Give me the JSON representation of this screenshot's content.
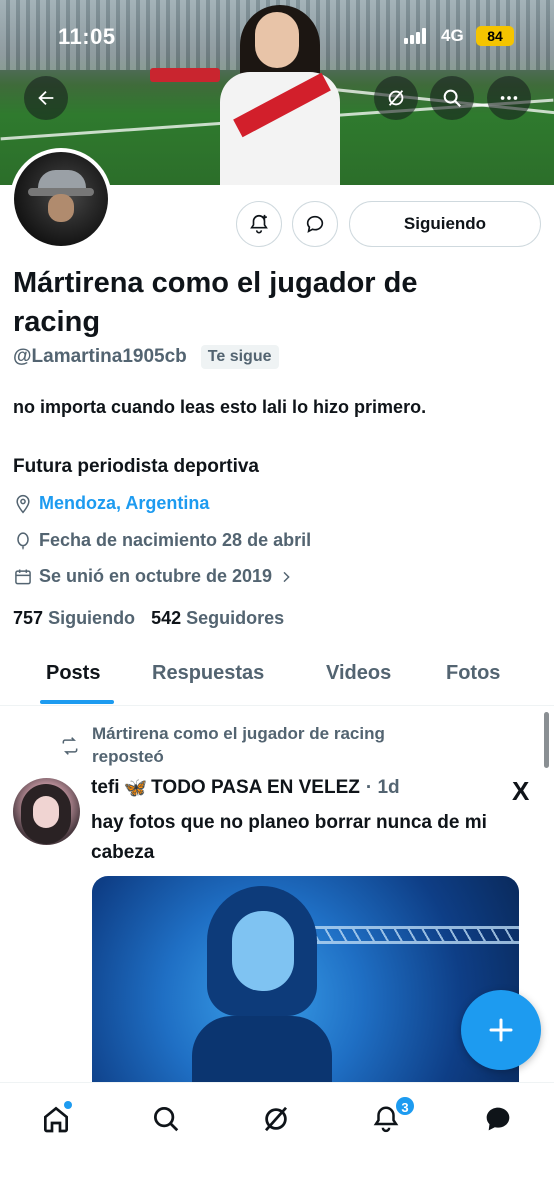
{
  "status_bar": {
    "time": "11:05",
    "network": "4G",
    "battery": "84"
  },
  "profile": {
    "name": "Mártirena como el jugador de racing",
    "handle": "@Lamartina1905cb",
    "follows_you": "Te sigue",
    "follow_button": "Siguiendo",
    "bio": "no importa cuando leas esto lali lo hizo primero.",
    "bio_line2": "Futura periodista deportiva",
    "location": "Mendoza, Argentina",
    "birthday": "Fecha de nacimiento 28 de abril",
    "joined": "Se unió en octubre de 2019",
    "following_count": "757",
    "following_label": "Siguiendo",
    "followers_count": "542",
    "followers_label": "Seguidores"
  },
  "tabs": [
    "Posts",
    "Respuestas",
    "Videos",
    "Fotos"
  ],
  "active_tab": "Posts",
  "post": {
    "repost_label": "Mártirena como el jugador de racing reposteó",
    "author": "tefi",
    "author_emoji": "🦋",
    "author_suffix": "TODO PASA EN VELEZ",
    "time": "· 1d",
    "text": "hay fotos que no planeo borrar nunca de mi cabeza",
    "source_badge": "X"
  },
  "bottom_nav": {
    "items": [
      "home-icon",
      "search-icon",
      "grok-icon",
      "notifications-icon",
      "messages-icon"
    ],
    "notification_count": "3"
  },
  "colors": {
    "accent": "#1d9bf0",
    "text": "#0f1419",
    "secondary": "#536471",
    "battery": "#f5c400"
  }
}
